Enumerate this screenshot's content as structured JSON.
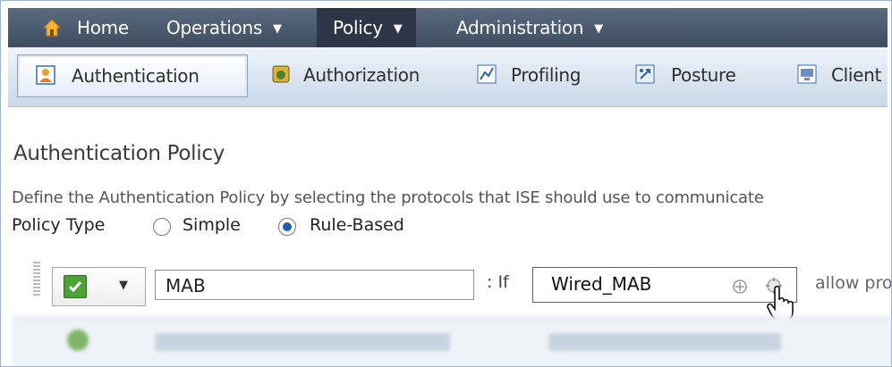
{
  "top_nav": {
    "items": [
      {
        "label": "Home",
        "icon": "home-icon"
      },
      {
        "label": "Operations",
        "has_menu": true
      },
      {
        "label": "Policy",
        "has_menu": true,
        "active": true
      },
      {
        "label": "Administration",
        "has_menu": true
      }
    ]
  },
  "sub_nav": {
    "tabs": [
      {
        "label": "Authentication",
        "icon": "user-icon",
        "active": true
      },
      {
        "label": "Authorization",
        "icon": "authorization-icon"
      },
      {
        "label": "Profiling",
        "icon": "profiling-icon"
      },
      {
        "label": "Posture",
        "icon": "posture-icon"
      },
      {
        "label": "Client P",
        "icon": "client-provisioning-icon"
      }
    ]
  },
  "page": {
    "title": "Authentication Policy",
    "description": "Define the Authentication Policy by selecting the protocols that ISE should use to communicate",
    "policy_type": {
      "label": "Policy Type",
      "options": [
        {
          "label": "Simple",
          "selected": false
        },
        {
          "label": "Rule-Based",
          "selected": true
        }
      ]
    }
  },
  "rule": {
    "enabled": true,
    "name": "MAB",
    "if_label": ": If",
    "condition": "Wired_MAB",
    "allow_label": "allow pro"
  },
  "colors": {
    "nav_bg": "#4a576b",
    "nav_active": "#2d3646",
    "subnav_bg": "#dbe6f1",
    "check_green": "#4da137",
    "radio_selected": "#1d5fb0"
  }
}
